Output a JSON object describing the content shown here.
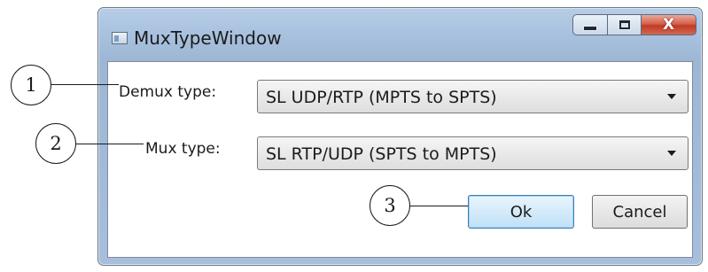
{
  "window": {
    "title": "MuxTypeWindow",
    "close_glyph": "X",
    "icons": [
      "app-icon",
      "minimize-icon",
      "maximize-icon",
      "close-icon"
    ]
  },
  "form": {
    "demux_label": "Demux type:",
    "demux_value": "SL UDP/RTP (MPTS to SPTS)",
    "mux_label": "Mux type:",
    "mux_value": "SL RTP/UDP (SPTS to MPTS)"
  },
  "buttons": {
    "ok": "Ok",
    "cancel": "Cancel"
  },
  "callouts": [
    "1",
    "2",
    "3"
  ],
  "colors": {
    "close_button": "#c23a23",
    "ok_button_border": "#3c7fb1",
    "window_frame": "#a9c2df"
  }
}
